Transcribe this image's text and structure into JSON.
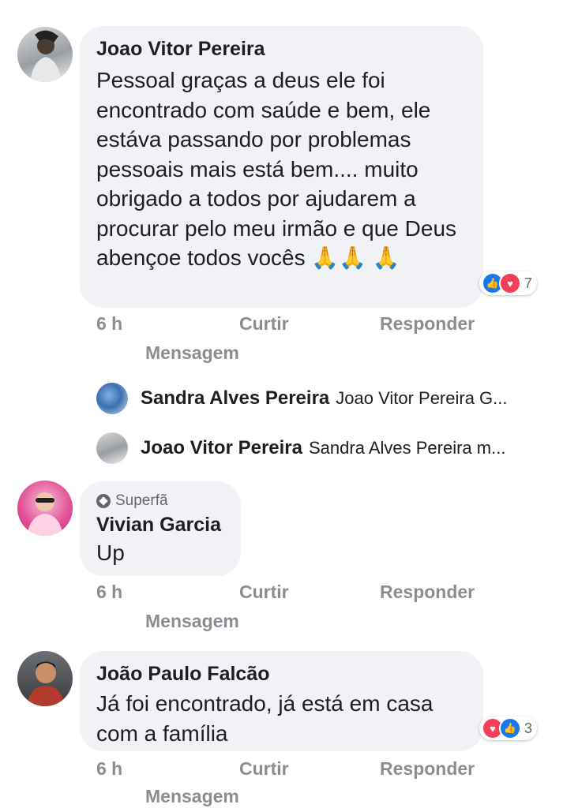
{
  "comments": [
    {
      "author": "Joao Vitor Pereira",
      "text": "Pessoal graças a deus ele foi encontrado com saúde e bem, ele estáva passando por problemas pessoais mais está bem.... muito obrigado a todos por ajudarem a procurar pelo meu irmão e que Deus abençoe todos vocês 🙏🙏 🙏",
      "reactions": {
        "icons": [
          "like-icon",
          "love-icon"
        ],
        "count": "7"
      },
      "time": "6 h",
      "like_label": "Curtir",
      "reply_label": "Responder",
      "message_label": "Mensagem"
    },
    {
      "badge": "Superfã",
      "author": "Vivian Garcia",
      "text": "Up",
      "time": "6 h",
      "like_label": "Curtir",
      "reply_label": "Responder",
      "message_label": "Mensagem"
    },
    {
      "author": "João Paulo Falcão",
      "text": "Já foi encontrado, já está em casa com a família",
      "reactions": {
        "icons": [
          "love-icon",
          "like-icon"
        ],
        "count": "3"
      },
      "time": "6 h",
      "like_label": "Curtir",
      "reply_label": "Responder",
      "message_label": "Mensagem"
    }
  ],
  "replies": [
    {
      "author": "Sandra Alves Pereira",
      "preview": "Joao Vitor Pereira  G..."
    },
    {
      "author": "Joao Vitor Pereira",
      "preview": "Sandra Alves Pereira m..."
    }
  ],
  "colors": {
    "bubble": "#f0f2f5",
    "meta_text": "#8a8d91",
    "like_blue": "#1877f2",
    "love_red": "#f33e58"
  }
}
